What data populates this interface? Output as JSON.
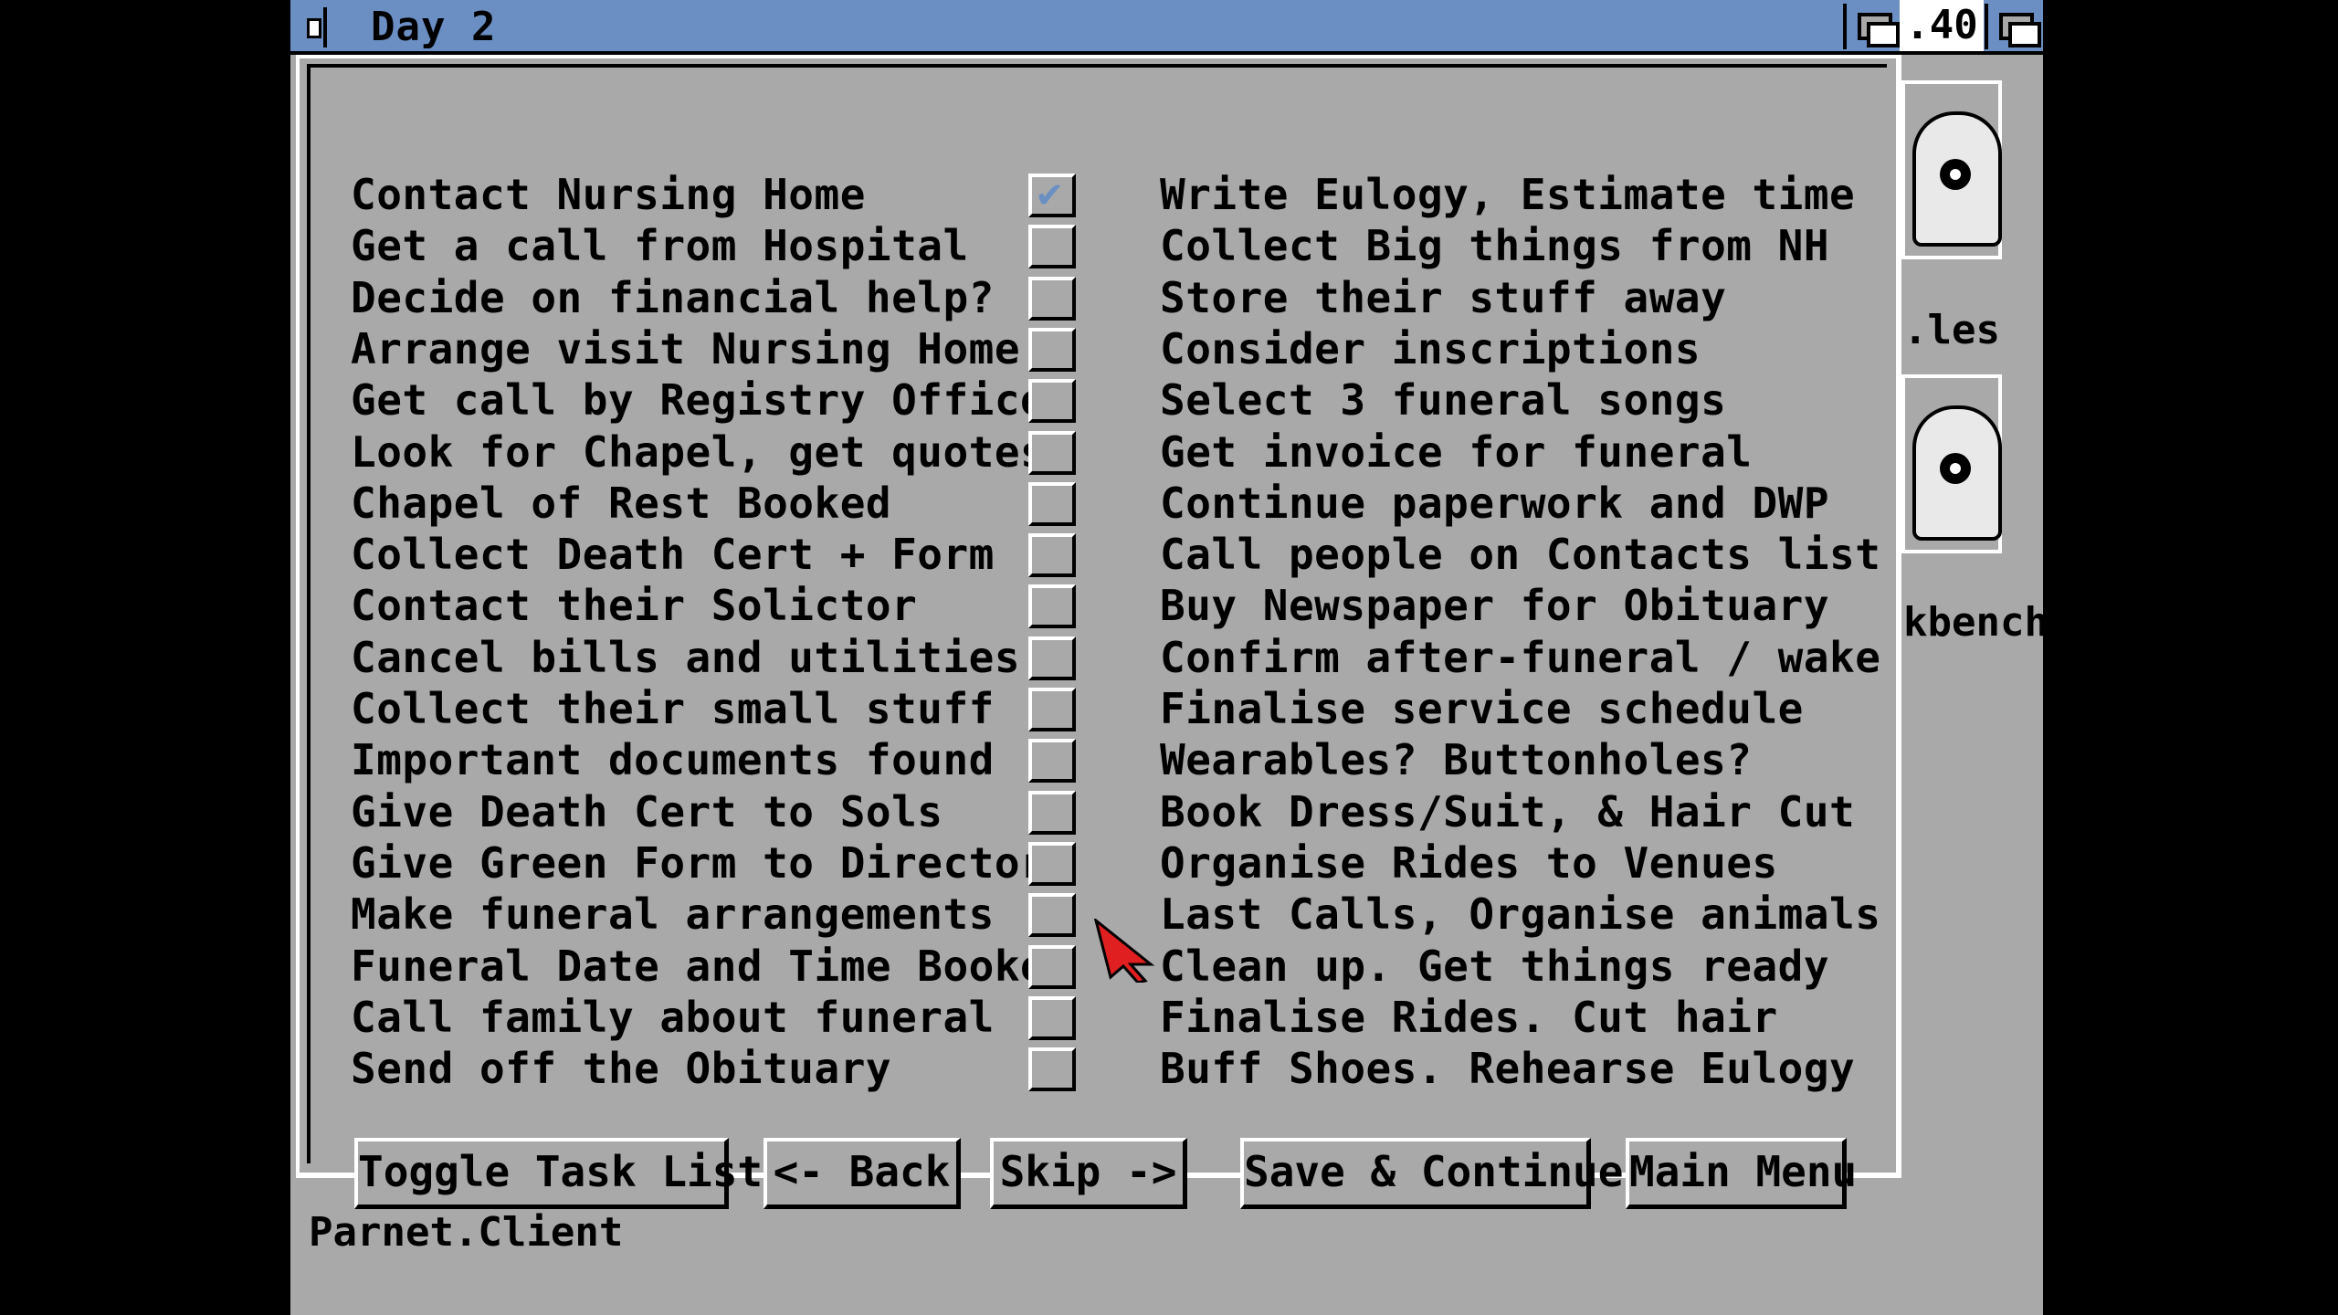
{
  "window": {
    "title": "Day 2",
    "title_fragment": ".40"
  },
  "tasks": {
    "left": [
      {
        "label": "Contact Nursing Home",
        "checked": true
      },
      {
        "label": "Get a call from Hospital",
        "checked": false
      },
      {
        "label": "Decide on financial help?",
        "checked": false
      },
      {
        "label": "Arrange visit Nursing Home",
        "checked": false
      },
      {
        "label": "Get call by Registry Office",
        "checked": false
      },
      {
        "label": "Look for Chapel, get quotes",
        "checked": false
      },
      {
        "label": "Chapel of Rest Booked",
        "checked": false
      },
      {
        "label": "Collect Death Cert + Form",
        "checked": false
      },
      {
        "label": "Contact their Solictor",
        "checked": false
      },
      {
        "label": "Cancel bills and utilities",
        "checked": false
      },
      {
        "label": "Collect their small stuff",
        "checked": false
      },
      {
        "label": "Important documents found",
        "checked": false
      },
      {
        "label": "Give Death Cert to Sols",
        "checked": false
      },
      {
        "label": "Give Green Form to Director",
        "checked": false
      },
      {
        "label": "Make funeral arrangements",
        "checked": false
      },
      {
        "label": "Funeral Date and Time Booked",
        "checked": false
      },
      {
        "label": "Call family about funeral",
        "checked": false
      },
      {
        "label": "Send off the Obituary",
        "checked": false
      }
    ],
    "right": [
      {
        "label": "Write Eulogy, Estimate time",
        "checked": false
      },
      {
        "label": "Collect Big things from NH",
        "checked": false
      },
      {
        "label": "Store their stuff away",
        "checked": false
      },
      {
        "label": "Consider inscriptions",
        "checked": false
      },
      {
        "label": "Select 3 funeral songs",
        "checked": false
      },
      {
        "label": "Get invoice for funeral",
        "checked": false
      },
      {
        "label": "Continue paperwork and DWP",
        "checked": false
      },
      {
        "label": "Call people on Contacts list",
        "checked": false
      },
      {
        "label": "Buy Newspaper for Obituary",
        "checked": false
      },
      {
        "label": "Confirm after-funeral / wake",
        "checked": false
      },
      {
        "label": "Finalise service schedule",
        "checked": false
      },
      {
        "label": "Wearables? Buttonholes?",
        "checked": false
      },
      {
        "label": "Book Dress/Suit, & Hair Cut",
        "checked": false
      },
      {
        "label": "Organise Rides to Venues",
        "checked": false
      },
      {
        "label": "Last Calls, Organise animals",
        "checked": false
      },
      {
        "label": "Clean up. Get things ready",
        "checked": false
      },
      {
        "label": "Finalise Rides. Cut hair",
        "checked": false
      },
      {
        "label": "Buff Shoes. Rehearse Eulogy",
        "checked": false
      }
    ],
    "check_mark": "✔"
  },
  "buttons": {
    "toggle": "Toggle Task List",
    "back": "<- Back",
    "skip": "Skip ->",
    "save": "Save & Continue",
    "main_menu": "Main Menu"
  },
  "desktop": {
    "icon1_label": ".les",
    "icon2_label": "kbench",
    "parnet_label": "Parnet.Client"
  },
  "colors": {
    "titlebar": "#6b8fc3",
    "background": "#a9a9a9",
    "pointer": "#e02020"
  }
}
